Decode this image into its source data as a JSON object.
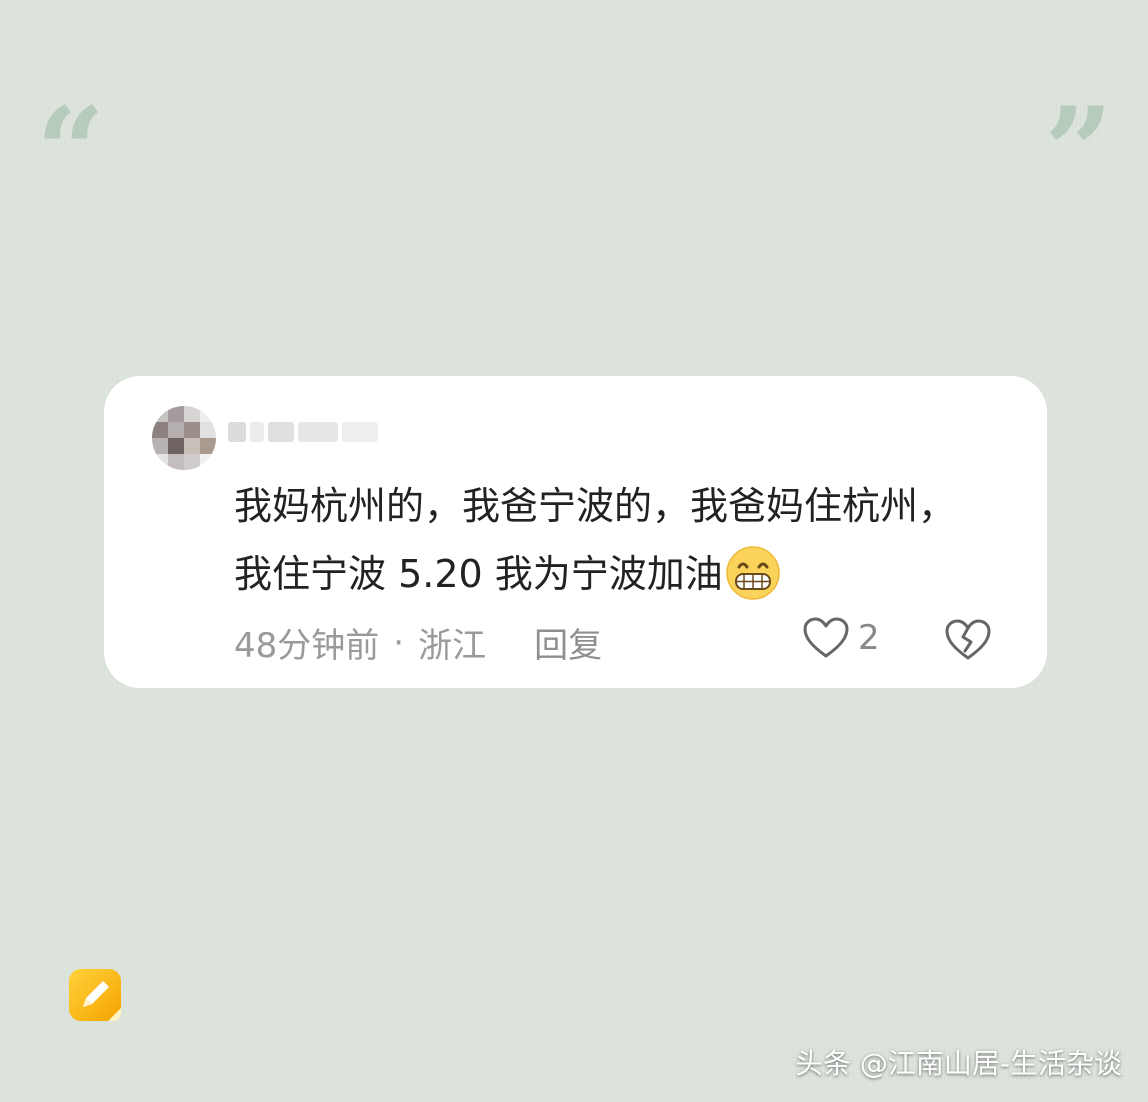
{
  "decor": {
    "open_quote": "“",
    "close_quote": "”",
    "quote_color": "#b7cbbd",
    "background_color": "#dbe3db"
  },
  "comment": {
    "text_line1": "我妈杭州的，我爸宁波的，我爸妈住杭州，",
    "text_line2": "我住宁波 5.20 我为宁波加油",
    "emoji": "grinning-face-emoji",
    "time": "48分钟前",
    "separator": "·",
    "location": "浙江",
    "reply_label": "回复",
    "like_count": "2"
  },
  "watermark": "头条 @江南山居-生活杂谈"
}
